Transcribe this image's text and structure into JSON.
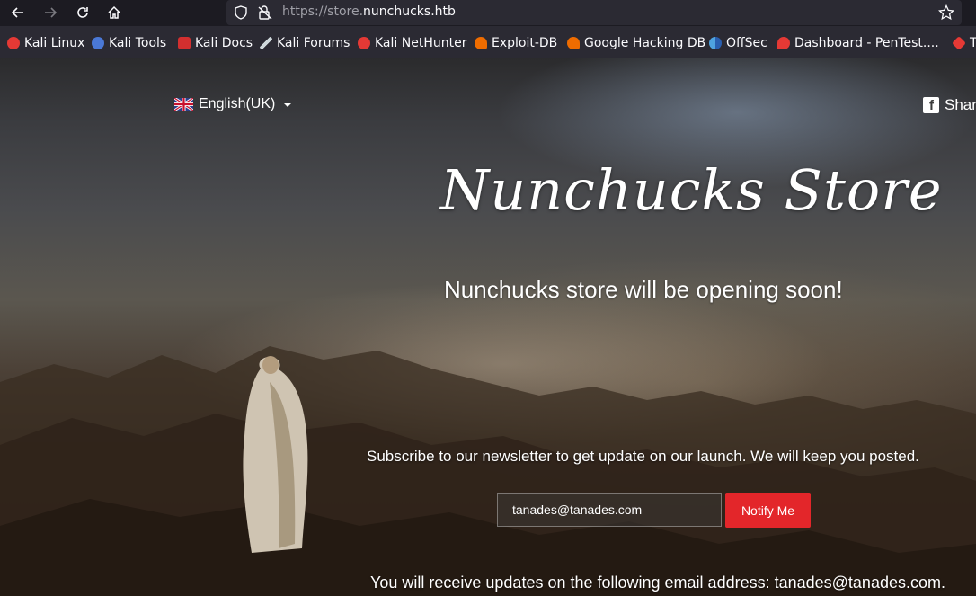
{
  "browser": {
    "url_prefix": "https://store.",
    "url_domain": "nunchucks.htb",
    "bookmarks": [
      {
        "label": "Kali Linux",
        "icon": "kali-dragon-icon",
        "color": "#e53935"
      },
      {
        "label": "Kali Tools",
        "icon": "kali-tools-icon",
        "color": "#4a78d6"
      },
      {
        "label": "Kali Docs",
        "icon": "kali-docs-icon",
        "color": "#d32f2f"
      },
      {
        "label": "Kali Forums",
        "icon": "kali-forums-icon",
        "color": "#cfd8dc"
      },
      {
        "label": "Kali NetHunter",
        "icon": "kali-nethunter-icon",
        "color": "#e53935"
      },
      {
        "label": "Exploit-DB",
        "icon": "exploit-db-icon",
        "color": "#ef6c00"
      },
      {
        "label": "Google Hacking DB",
        "icon": "ghdb-icon",
        "color": "#ef6c00"
      },
      {
        "label": "OffSec",
        "icon": "offsec-icon",
        "color": "#4fa3e0"
      },
      {
        "label": "Dashboard - PenTest....",
        "icon": "pentest-icon",
        "color": "#e53935"
      },
      {
        "label": "T",
        "icon": "bookmark-icon",
        "color": "#e53935"
      }
    ]
  },
  "page": {
    "language": "English(UK)",
    "share": "Share",
    "title": "Nunchucks Store",
    "subtitle": "Nunchucks store will be opening soon!",
    "newsletter_text": "Subscribe to our newsletter to get update on our launch. We will keep you posted.",
    "email_value": "tanades@tanades.com",
    "notify_label": "Notify Me",
    "confirmation": "You will receive updates on the following email address: tanades@tanades.com."
  },
  "colors": {
    "notify_button": "#e3262a",
    "chrome_bg": "#1c1b22",
    "toolbar_bg": "#2b2a33"
  }
}
